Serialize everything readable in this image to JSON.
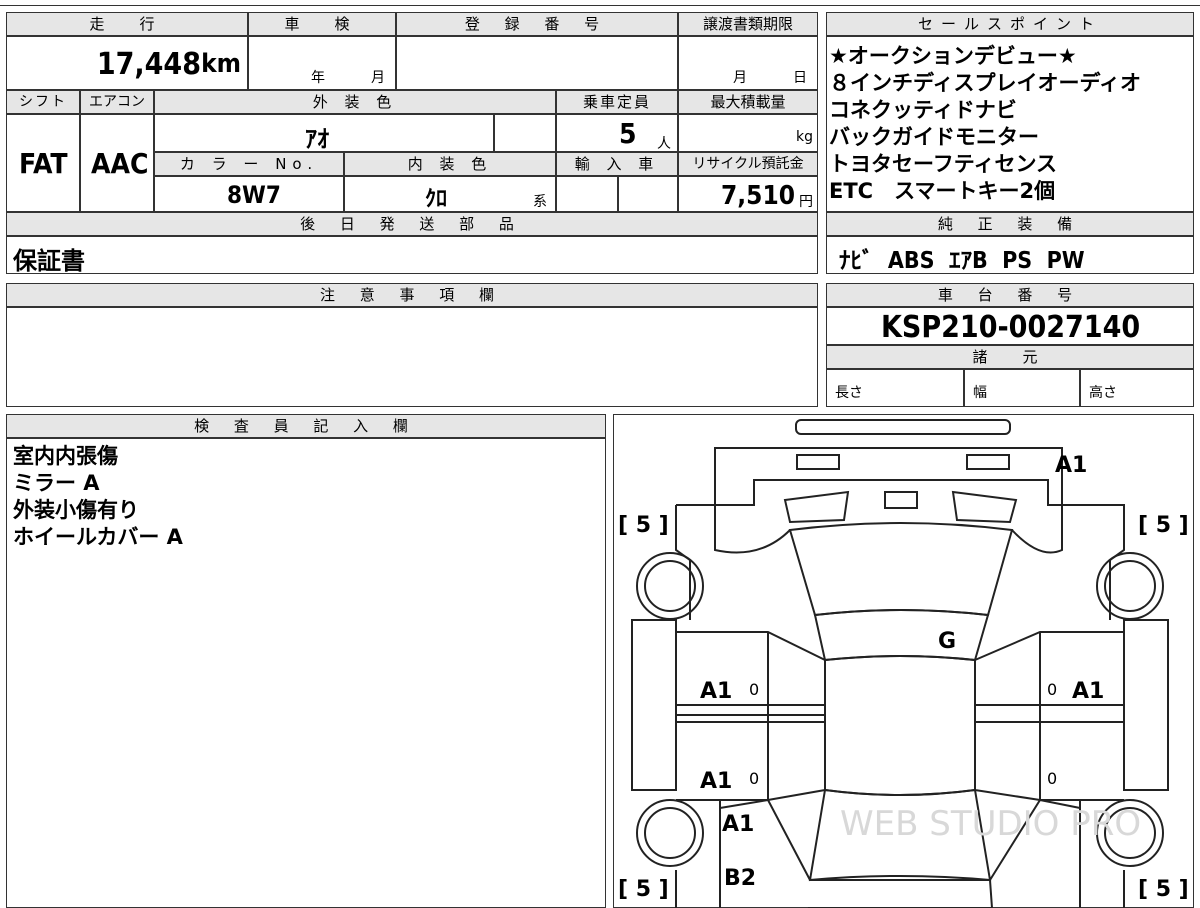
{
  "header": {
    "mileage_label": "走　行",
    "shaken_label": "車　検",
    "reg_label": "登 録 番 号",
    "transfer_label": "譲渡書類期限",
    "sales_label": "セールスポイント"
  },
  "values": {
    "mileage": "17,448",
    "mileage_unit": "km",
    "shaken_year": "年",
    "shaken_month": "月",
    "transfer_month": "月",
    "transfer_day": "日"
  },
  "labels": {
    "shift": "シフト",
    "aircon": "エアコン",
    "exterior": "外 装 色",
    "capacity": "乗車定員",
    "max_load": "最大積載量",
    "color_no": "カ ラ ー No.",
    "interior": "内 装 色",
    "import": "輸 入 車",
    "recycle": "リサイクル預託金",
    "later_parts": "後 日 発 送 部 品",
    "notes": "注 意 事 項 欄",
    "inspector": "検 査 員 記 入 欄",
    "genuine": "純 正 装 備",
    "chassis": "車 台 番 号",
    "specs": "諸　元",
    "length": "長さ",
    "width": "幅",
    "height": "高さ"
  },
  "vehicle": {
    "shift": "FAT",
    "aircon": "AAC",
    "exterior_color": "ｱｵ",
    "capacity": "5",
    "capacity_unit": "人",
    "load_unit": "kg",
    "color_no": "8W7",
    "interior_color": "ｸﾛ",
    "interior_suffix": "系",
    "recycle_fee": "7,510",
    "recycle_unit": "円",
    "later_parts": "保証書",
    "chassis_no": "KSP210-0027140",
    "genuine_equipment": "ﾅﾋﾞ  ABS  ｴｱB  PS  PW"
  },
  "sales_points": [
    "★オークションデビュー★",
    "８インチディスプレイオーディオ",
    "コネクッティドナビ",
    "バックガイドモニター",
    "トヨタセーフティセンス",
    "ETC　スマートキー2個"
  ],
  "inspector_notes": [
    "室内内張傷",
    "ミラー A",
    "外装小傷有り",
    "ホイールカバー A"
  ],
  "diagram": {
    "tire_tl": "[ 5 ]",
    "tire_tr": "[ 5 ]",
    "tire_bl": "[ 5 ]",
    "tire_br": "[ 5 ]",
    "rear_mark": "A1",
    "roof_mark": "G",
    "left_front_door": "A1",
    "right_front_door": "A1",
    "left_rear_door": "A1",
    "left_rear_fender": "A1",
    "left_bumper_corner": "B2",
    "zero_1": "0",
    "zero_2": "0",
    "zero_3": "0",
    "zero_4": "0",
    "watermark": "WEB STUDIO PRO"
  }
}
